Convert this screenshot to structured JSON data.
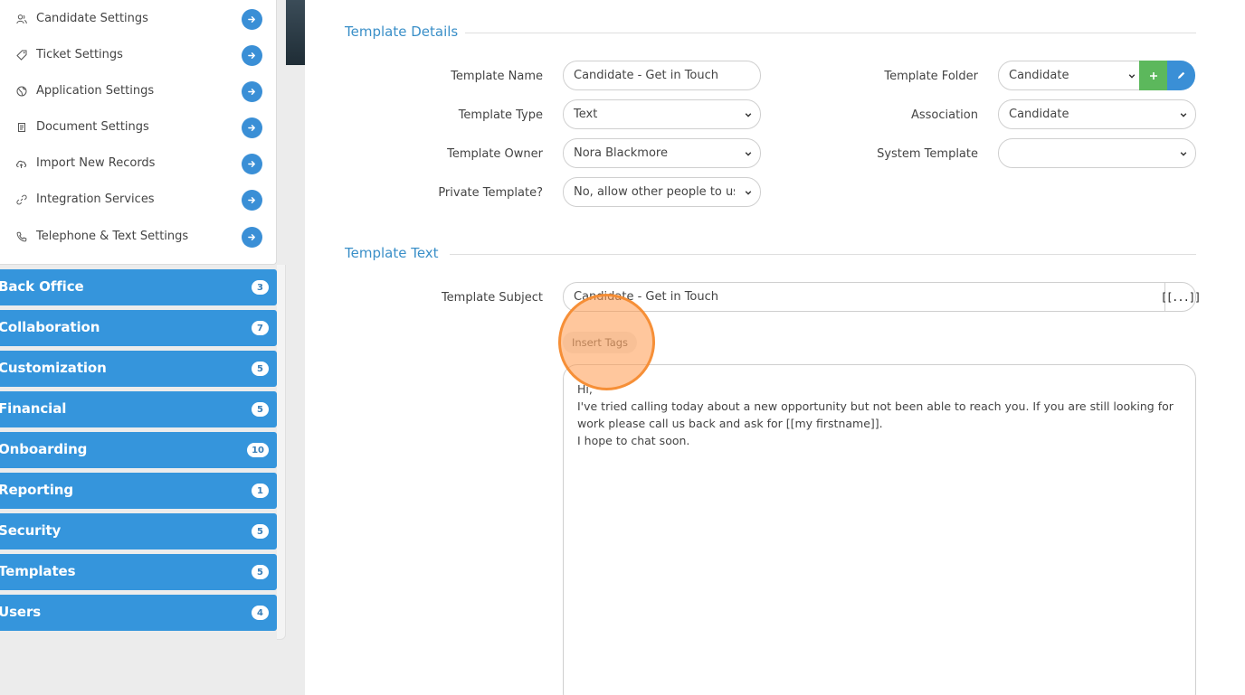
{
  "sidebar": {
    "settings": [
      {
        "label": "Candidate Settings",
        "icon": "users-icon"
      },
      {
        "label": "Ticket Settings",
        "icon": "tag-icon"
      },
      {
        "label": "Application Settings",
        "icon": "globe-icon"
      },
      {
        "label": "Document Settings",
        "icon": "document-icon"
      },
      {
        "label": "Import New Records",
        "icon": "cloud-upload-icon"
      },
      {
        "label": "Integration Services",
        "icon": "link-icon"
      },
      {
        "label": "Telephone & Text Settings",
        "icon": "phone-icon"
      }
    ],
    "categories": [
      {
        "label": "Back Office",
        "count": "3"
      },
      {
        "label": "Collaboration",
        "count": "7"
      },
      {
        "label": "Customization",
        "count": "5"
      },
      {
        "label": "Financial",
        "count": "5"
      },
      {
        "label": "Onboarding",
        "count": "10"
      },
      {
        "label": "Reporting",
        "count": "1"
      },
      {
        "label": "Security",
        "count": "5"
      },
      {
        "label": "Templates",
        "count": "5"
      },
      {
        "label": "Users",
        "count": "4"
      }
    ]
  },
  "template_details": {
    "title": "Template Details",
    "template_name_label": "Template Name",
    "template_name_value": "Candidate - Get in Touch",
    "template_type_label": "Template Type",
    "template_type_value": "Text",
    "template_owner_label": "Template Owner",
    "template_owner_value": "Nora Blackmore",
    "private_template_label": "Private Template?",
    "private_template_value": "No, allow other people to use",
    "template_folder_label": "Template Folder",
    "template_folder_value": "Candidate",
    "association_label": "Association",
    "association_value": "Candidate",
    "system_template_label": "System Template",
    "system_template_value": ""
  },
  "template_text": {
    "title": "Template Text",
    "subject_label": "Template Subject",
    "subject_value": "Candidate - Get in Touch",
    "tag_button": "[[...]]",
    "insert_tags_label": "Insert Tags",
    "body_lines": [
      "Hi,",
      "I've tried calling today about a new opportunity but not been able to reach you. If you are still looking for",
      "work please call us back and ask for [[my firstname]].",
      "I hope to chat soon."
    ]
  },
  "colors": {
    "accent_blue": "#3595dc",
    "add_green": "#5cb85c",
    "edit_blue": "#3a8fd6",
    "click_highlight": "#ff994d"
  }
}
